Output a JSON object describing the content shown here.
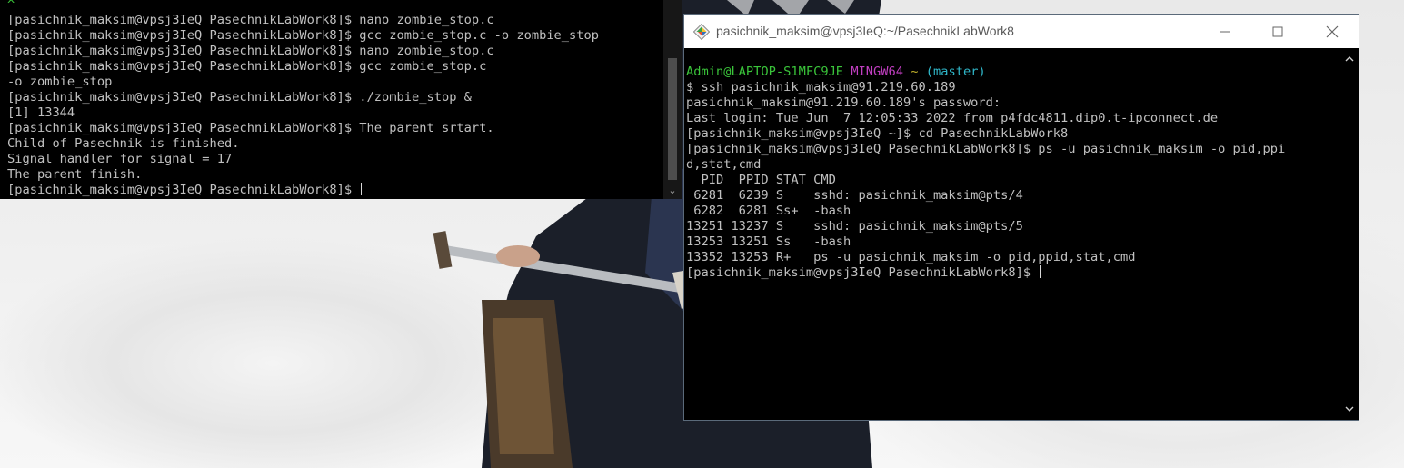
{
  "left_terminal": {
    "caret": "^",
    "lines": [
      "[pasichnik_maksim@vpsj3IeQ PasechnikLabWork8]$ nano zombie_stop.c",
      "[pasichnik_maksim@vpsj3IeQ PasechnikLabWork8]$ gcc zombie_stop.c -o zombie_stop",
      "[pasichnik_maksim@vpsj3IeQ PasechnikLabWork8]$ nano zombie_stop.c",
      "[pasichnik_maksim@vpsj3IeQ PasechnikLabWork8]$ gcc zombie_stop.c",
      "-o zombie_stop",
      "[pasichnik_maksim@vpsj3IeQ PasechnikLabWork8]$ ./zombie_stop &",
      "[1] 13344",
      "[pasichnik_maksim@vpsj3IeQ PasechnikLabWork8]$ The parent srtart.",
      "Child of Pasechnik is finished.",
      "Signal handler for signal = 17",
      "The parent finish.",
      "[pasichnik_maksim@vpsj3IeQ PasechnikLabWork8]$ "
    ]
  },
  "right_window": {
    "title": "pasichnik_maksim@vpsj3IeQ:~/PasechnikLabWork8",
    "prompt_user": "Admin@LAPTOP-S1MFC9JE",
    "prompt_env": "MINGW64",
    "prompt_path": "~",
    "prompt_branch": "(master)",
    "lines": [
      "$ ssh pasichnik_maksim@91.219.60.189",
      "pasichnik_maksim@91.219.60.189's password:",
      "Last login: Tue Jun  7 12:05:33 2022 from p4fdc4811.dip0.t-ipconnect.de",
      "[pasichnik_maksim@vpsj3IeQ ~]$ cd PasechnikLabWork8",
      "[pasichnik_maksim@vpsj3IeQ PasechnikLabWork8]$ ps -u pasichnik_maksim -o pid,ppi",
      "d,stat,cmd",
      "  PID  PPID STAT CMD",
      " 6281  6239 S    sshd: pasichnik_maksim@pts/4",
      " 6282  6281 Ss+  -bash",
      "13251 13237 S    sshd: pasichnik_maksim@pts/5",
      "13253 13251 Ss   -bash",
      "13352 13253 R+   ps -u pasichnik_maksim -o pid,ppid,stat,cmd",
      "[pasichnik_maksim@vpsj3IeQ PasechnikLabWork8]$ "
    ]
  },
  "colors": {
    "prompt_green": "#3ac43a",
    "prompt_magenta": "#c23fc2",
    "prompt_yellow": "#c0b02a",
    "prompt_cyan": "#2fb6c8"
  },
  "icons": {
    "app": "git-bash-diamond-icon",
    "minimize": "minimize-icon",
    "maximize": "maximize-icon",
    "close": "close-icon"
  }
}
